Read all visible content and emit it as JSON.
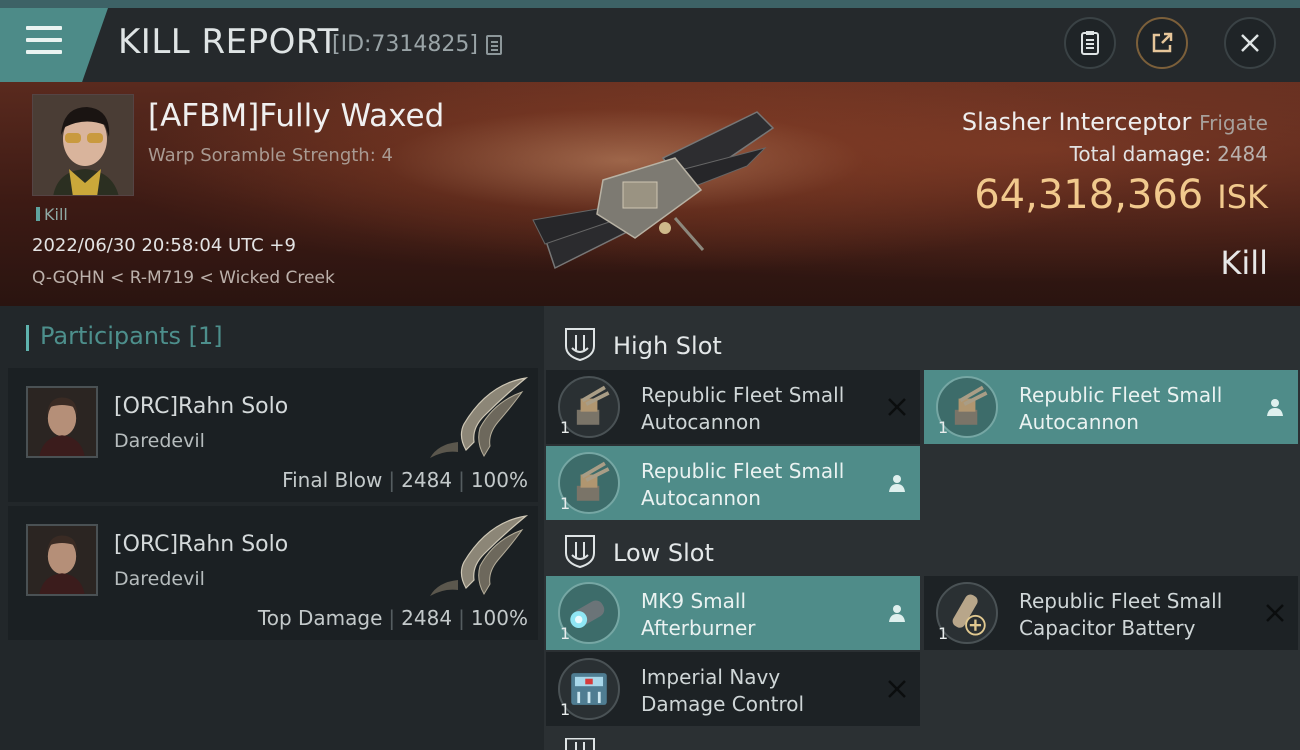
{
  "header": {
    "title": "KILL REPORT",
    "id": "[ID:7314825]"
  },
  "victim": {
    "name": "[AFBM]Fully Waxed",
    "subtitle": "Warp Soramble Strength: 4",
    "kill_tag": "Kill",
    "datetime": "2022/06/30 20:58:04 UTC +9",
    "location": "Q-GQHN < R-M719 < Wicked Creek"
  },
  "ship": {
    "name": "Slasher Interceptor",
    "class": "Frigate",
    "total_damage_label": "Total damage:",
    "total_damage": "2484",
    "isk_value": "64,318,366",
    "isk_unit": "ISK",
    "result": "Kill"
  },
  "participants": {
    "title": "Participants",
    "count": "[1]",
    "items": [
      {
        "name": "[ORC]Rahn Solo",
        "ship": "Daredevil",
        "role": "Final Blow",
        "damage": "2484",
        "percent": "100%"
      },
      {
        "name": "[ORC]Rahn Solo",
        "ship": "Daredevil",
        "role": "Top Damage",
        "damage": "2484",
        "percent": "100%"
      }
    ]
  },
  "slots": {
    "high": {
      "label": "High Slot",
      "modules": [
        {
          "line1": "Republic Fleet Small",
          "line2": "Autocannon",
          "qty": "1",
          "status": "destroyed"
        },
        {
          "line1": "Republic Fleet Small",
          "line2": "Autocannon",
          "qty": "1",
          "status": "dropped"
        },
        {
          "line1": "Republic Fleet Small",
          "line2": "Autocannon",
          "qty": "1",
          "status": "dropped"
        }
      ]
    },
    "low": {
      "label": "Low Slot",
      "modules": [
        {
          "line1": "MK9 Small",
          "line2": "Afterburner",
          "qty": "1",
          "status": "dropped"
        },
        {
          "line1": "Republic Fleet Small",
          "line2": "Capacitor Battery",
          "qty": "1",
          "status": "destroyed"
        },
        {
          "line1": "Imperial Navy",
          "line2": "Damage Control",
          "qty": "1",
          "status": "destroyed"
        }
      ]
    }
  },
  "colors": {
    "accent": "#4f8c89",
    "isk": "#f1c98d",
    "banner": "#4a2219"
  }
}
